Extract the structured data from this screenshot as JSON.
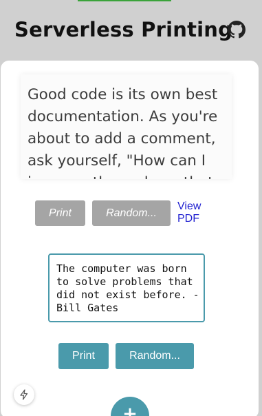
{
  "header": {
    "title": "Serverless Printing",
    "github_icon": "github-icon"
  },
  "quote_card": {
    "text": "Good code is its own best documentation. As you're about to add a comment, ask yourself, \"How can I improve the code so that this comment isn't needed?\" - Steve McConnell",
    "print_label": "Print",
    "random_label": "Random...",
    "view_pdf_label": "View PDF"
  },
  "quote_input": {
    "text": "The computer was born to solve problems that did not exist before. - Bill Gates",
    "print_label": "Print",
    "random_label": "Random..."
  },
  "floating": {
    "bolt_icon": "bolt-icon",
    "add_label": "+"
  },
  "colors": {
    "accent": "#4a9aab",
    "disabled": "#a5a5a5",
    "link": "#1f1fd0"
  }
}
